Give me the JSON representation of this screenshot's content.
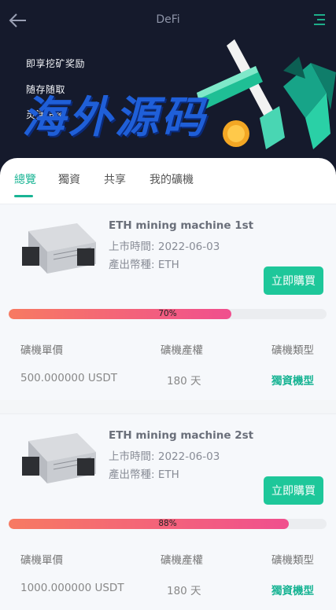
{
  "header": {
    "title": "DeFi",
    "back_icon": "arrow-left-icon",
    "menu_icon": "menu-lines-icon"
  },
  "banner": {
    "slogans": [
      "即享挖矿奖励",
      "随存随取",
      "灵活投资"
    ],
    "watermark": "海外源码"
  },
  "tabs": [
    {
      "label": "總覽",
      "active": true
    },
    {
      "label": "獨資"
    },
    {
      "label": "共享"
    },
    {
      "label": "我的礦機"
    }
  ],
  "products": [
    {
      "name": "ETH mining machine 1st",
      "listed_label": "上市時間:",
      "listed_date": "2022-06-03",
      "coin_label": "產出幣種:",
      "coin": "ETH",
      "buy_label": "立即購買",
      "progress": 70,
      "progress_text": "70%",
      "price_label": "礦機單價",
      "term_label": "礦機產權",
      "type_label": "礦機類型",
      "price": "500.000000 USDT",
      "term": "180 天",
      "type": "獨資機型"
    },
    {
      "name": "ETH mining machine 2st",
      "listed_label": "上市時間:",
      "listed_date": "2022-06-03",
      "coin_label": "產出幣種:",
      "coin": "ETH",
      "buy_label": "立即購買",
      "progress": 88,
      "progress_text": "88%",
      "price_label": "礦機單價",
      "term_label": "礦機產權",
      "type_label": "礦機類型",
      "price": "1000.000000 USDT",
      "term": "180 天",
      "type": "獨資機型"
    }
  ],
  "colors": {
    "accent": "#19b494",
    "button": "#1ec79a",
    "hero_bg": "#151a2c",
    "progress_start": "#f77a62",
    "progress_end": "#f04f8e"
  }
}
